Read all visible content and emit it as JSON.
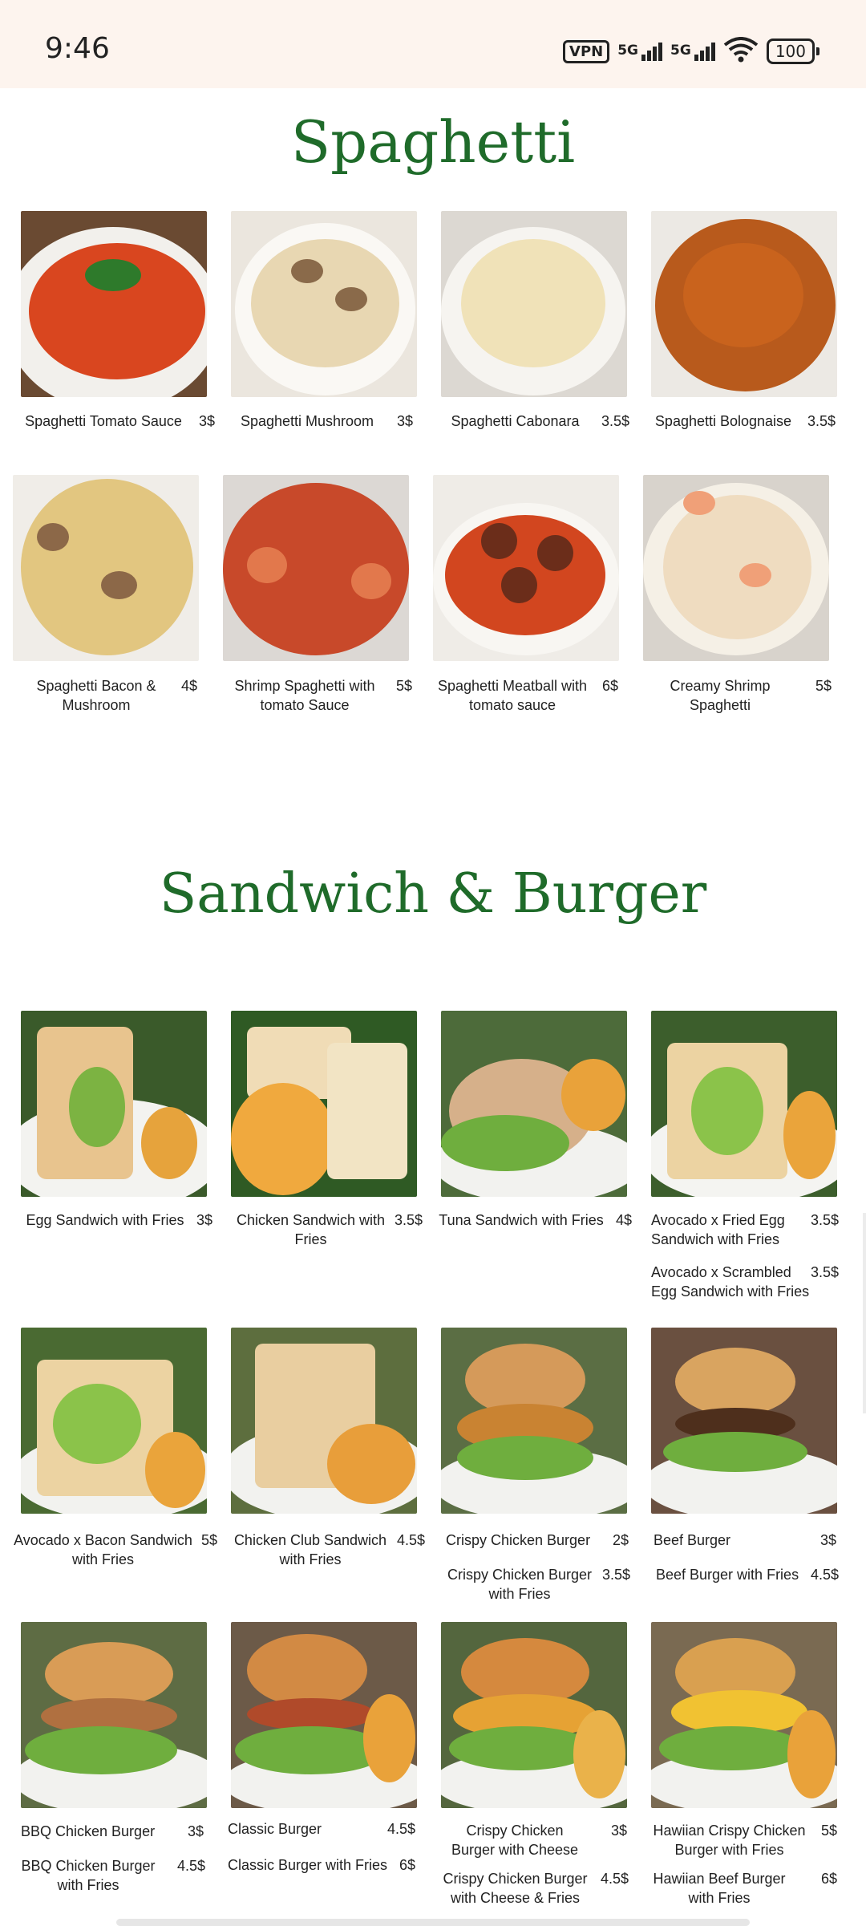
{
  "status": {
    "time": "9:46",
    "vpn": "VPN",
    "net1": "5G",
    "net2": "5G",
    "battery": "100"
  },
  "sections": {
    "spaghetti_title": "Spaghetti",
    "sandwich_title": "Sandwich & Burger"
  },
  "items": {
    "s1": {
      "name": "Spaghetti Tomato Sauce",
      "price": "3$"
    },
    "s2": {
      "name": "Spaghetti Mushroom",
      "price": "3$"
    },
    "s3": {
      "name": "Spaghetti Cabonara",
      "price": "3.5$"
    },
    "s4": {
      "name": "Spaghetti Bolognaise",
      "price": "3.5$"
    },
    "s5": {
      "name": "Spaghetti Bacon & Mushroom",
      "price": "4$"
    },
    "s6": {
      "name": "Shrimp Spaghetti with tomato Sauce",
      "price": "5$"
    },
    "s7": {
      "name": "Spaghetti Meatball with tomato sauce",
      "price": "6$"
    },
    "s8": {
      "name": "Creamy Shrimp Spaghetti",
      "price": "5$"
    },
    "b1": {
      "name": "Egg Sandwich with Fries",
      "price": "3$"
    },
    "b2": {
      "name": "Chicken Sandwich with Fries",
      "price": "3.5$"
    },
    "b3": {
      "name": "Tuna Sandwich with Fries",
      "price": "4$"
    },
    "b4": {
      "name": "Avocado x Fried Egg Sandwich with Fries",
      "price": "3.5$"
    },
    "b4b": {
      "name": "Avocado x Scrambled Egg Sandwich with Fries",
      "price": "3.5$"
    },
    "b5": {
      "name": "Avocado x Bacon Sandwich with Fries",
      "price": "5$"
    },
    "b6": {
      "name": "Chicken Club Sandwich with Fries",
      "price": "4.5$"
    },
    "b7": {
      "name": "Crispy Chicken Burger",
      "price": "2$"
    },
    "b7b": {
      "name": "Crispy Chicken Burger with Fries",
      "price": "3.5$"
    },
    "b8": {
      "name": "Beef Burger",
      "price": "3$"
    },
    "b8b": {
      "name": "Beef Burger with Fries",
      "price": "4.5$"
    },
    "b9": {
      "name": "BBQ Chicken Burger",
      "price": "3$"
    },
    "b9b": {
      "name": "BBQ Chicken Burger with Fries",
      "price": "4.5$"
    },
    "b10": {
      "name": "Classic Burger",
      "price": "4.5$"
    },
    "b10b": {
      "name": "Classic Burger with Fries",
      "price": "6$"
    },
    "b11": {
      "name": "Crispy Chicken Burger with Cheese",
      "price": "3$"
    },
    "b11b": {
      "name": "Crispy Chicken Burger with Cheese & Fries",
      "price": "4.5$"
    },
    "b12": {
      "name": "Hawiian Crispy Chicken Burger with Fries",
      "price": "5$"
    },
    "b12b": {
      "name": "Hawiian Beef Burger with Fries",
      "price": "6$"
    }
  },
  "colors": {
    "title_green": "#1f6b2a",
    "status_bg": "#fdf4ee"
  }
}
